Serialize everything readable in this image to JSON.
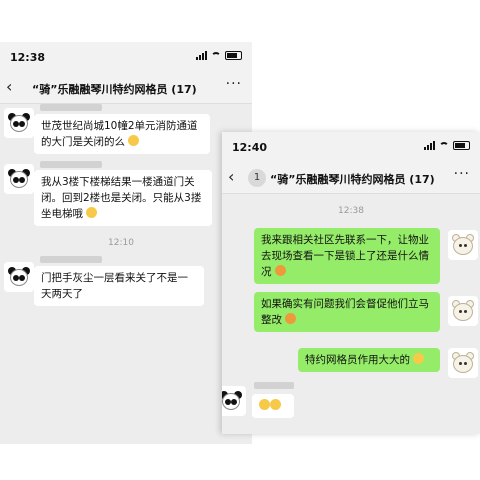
{
  "left_screen": {
    "status_time": "12:38",
    "nav": {
      "back": "‹",
      "title": "“骑”乐融融琴川特约网格员 (17)",
      "more": "···"
    },
    "messages": [
      {
        "text": "世茂世纪尚城10幢2单元消防通道的大门是关闭的么"
      },
      {
        "text": "我从3楼下楼梯结果一楼通道门关闭。回到2楼也是关闭。只能从3搂坐电梯哦"
      },
      {
        "text": "门把手灰尘一层看来关了不是一天两天了"
      }
    ],
    "timestamp": "12:10"
  },
  "right_screen": {
    "status_time": "12:40",
    "nav": {
      "back": "‹",
      "badge": "1",
      "title": "“骑”乐融融琴川特约网格员 (17)",
      "more": "···"
    },
    "timestamp": "12:38",
    "messages": [
      {
        "text": "我来跟相关社区先联系一下，让物业去现场查看一下是锁上了还是什么情况"
      },
      {
        "text": "如果确实有问题我们会督促他们立马整改"
      },
      {
        "text": "特约网格员作用大大的"
      }
    ]
  },
  "icons": [
    "panda-avatar",
    "bear-avatar",
    "thumbs-up-emoji",
    "grin-emoji",
    "fist-emoji",
    "smile-emoji",
    "clap-emoji"
  ]
}
